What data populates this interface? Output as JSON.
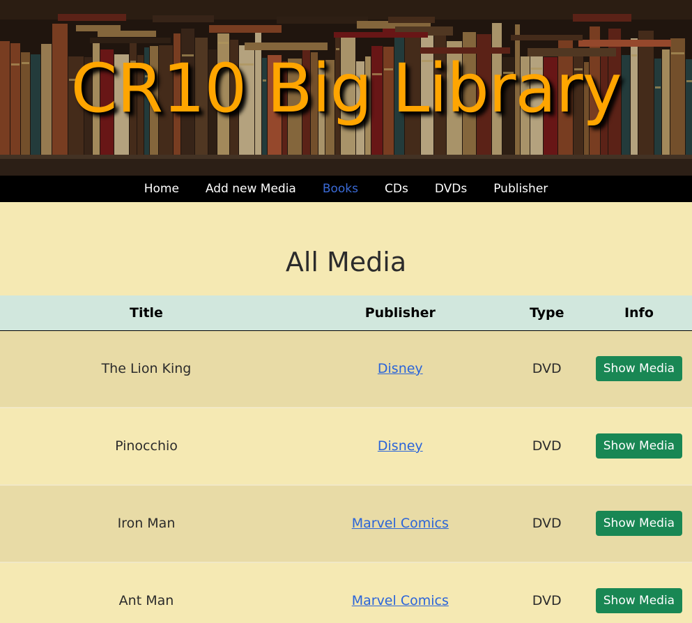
{
  "header": {
    "title": "CR10 Big Library"
  },
  "nav": {
    "items": [
      "Home",
      "Add new Media",
      "Books",
      "CDs",
      "DVDs",
      "Publisher"
    ],
    "active": "Books"
  },
  "main": {
    "heading": "All Media",
    "columns": [
      "Title",
      "Publisher",
      "Type",
      "Info"
    ],
    "rows": [
      {
        "title": "The Lion King",
        "publisher": "Disney",
        "type": "DVD",
        "action": "Show Media"
      },
      {
        "title": "Pinocchio",
        "publisher": "Disney",
        "type": "DVD",
        "action": "Show Media"
      },
      {
        "title": "Iron Man",
        "publisher": "Marvel Comics",
        "type": "DVD",
        "action": "Show Media"
      },
      {
        "title": "Ant Man",
        "publisher": "Marvel Comics",
        "type": "DVD",
        "action": "Show Media"
      }
    ]
  },
  "colors": {
    "title": "#ffa500",
    "nav_bg": "#000000",
    "active_link": "#3a6ad6",
    "page_bg": "#f5e9b3",
    "table_head_bg": "#d1e7dd",
    "button": "#198754",
    "link": "#2a64d9"
  }
}
